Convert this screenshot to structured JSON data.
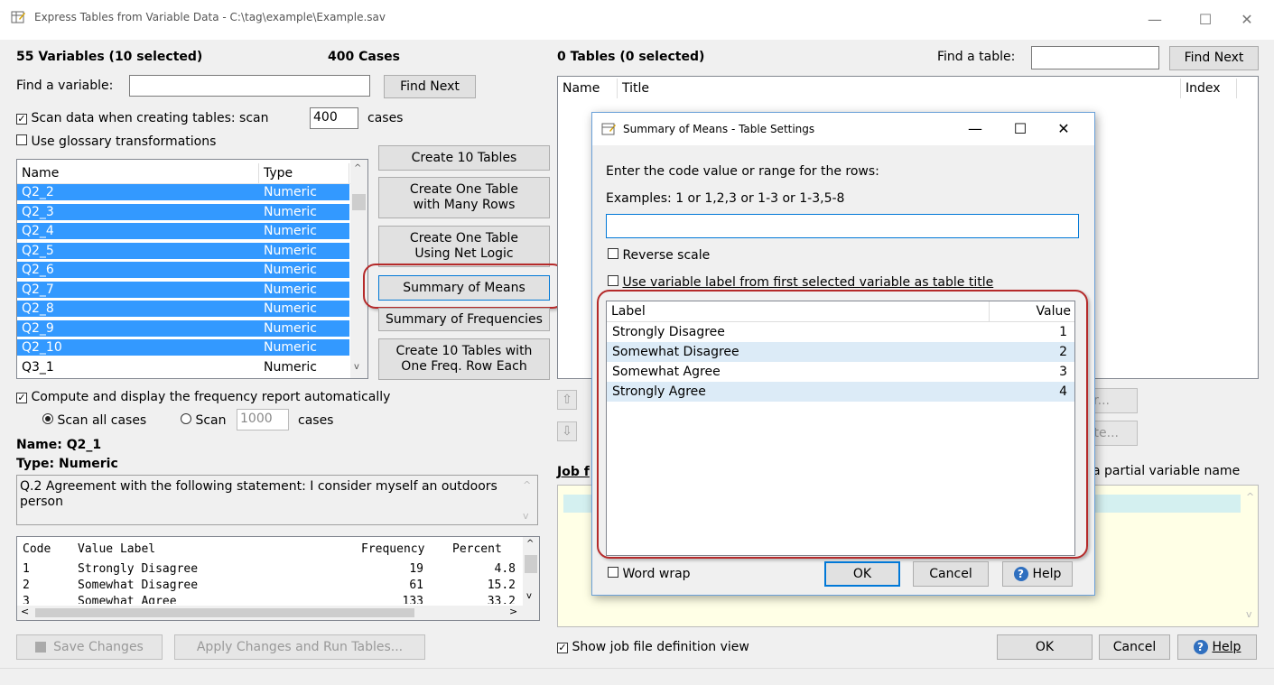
{
  "window": {
    "title": "Express Tables from Variable Data - C:\\tag\\example\\Example.sav",
    "minimize": "—",
    "maximize": "☐",
    "close": "✕"
  },
  "left": {
    "variables_count_label": "55 Variables  (10 selected)",
    "cases_label": "400 Cases",
    "find_variable_label": "Find a variable:",
    "find_variable_value": "",
    "find_next": "Find Next",
    "scan_data_label": "Scan data when creating tables:  scan",
    "scan_data_value": "400",
    "scan_cases_suffix": "cases",
    "glossary_label": "Use glossary transformations",
    "var_list_headers": {
      "name": "Name",
      "type": "Type"
    },
    "variables": [
      {
        "name": "Q2_2",
        "type": "Numeric",
        "selected": true
      },
      {
        "name": "Q2_3",
        "type": "Numeric",
        "selected": true
      },
      {
        "name": "Q2_4",
        "type": "Numeric",
        "selected": true
      },
      {
        "name": "Q2_5",
        "type": "Numeric",
        "selected": true
      },
      {
        "name": "Q2_6",
        "type": "Numeric",
        "selected": true
      },
      {
        "name": "Q2_7",
        "type": "Numeric",
        "selected": true
      },
      {
        "name": "Q2_8",
        "type": "Numeric",
        "selected": true
      },
      {
        "name": "Q2_9",
        "type": "Numeric",
        "selected": true
      },
      {
        "name": "Q2_10",
        "type": "Numeric",
        "selected": true
      },
      {
        "name": "Q3_1",
        "type": "Numeric",
        "selected": false
      }
    ],
    "compute_freq_label": "Compute and display the frequency report automatically",
    "scan_all_label": "Scan all cases",
    "scan_label": "Scan",
    "scan_value": "1000",
    "cases_label2": "cases",
    "name_line": "Name: Q2_1",
    "type_line": "Type: Numeric",
    "description": "Q.2 Agreement with the following statement: I consider myself an outdoors person",
    "freq_headers": {
      "code": "Code",
      "label": "Value Label",
      "freq": "Frequency",
      "pct": "Percent"
    },
    "freq_rows": [
      {
        "code": "1",
        "label": "Strongly Disagree",
        "freq": "19",
        "pct": "4.8"
      },
      {
        "code": "2",
        "label": "Somewhat Disagree",
        "freq": "61",
        "pct": "15.2"
      },
      {
        "code": "3",
        "label": "Somewhat Agree",
        "freq": "133",
        "pct": "33.2"
      }
    ],
    "save_changes": "Save Changes",
    "apply_run": "Apply Changes and Run Tables..."
  },
  "middle_buttons": {
    "create_10": "Create 10 Tables",
    "one_table_many_rows": [
      "Create One Table",
      "with Many Rows"
    ],
    "one_table_net": [
      "Create One Table",
      "Using Net Logic"
    ],
    "summary_means": "Summary of Means",
    "summary_freqs": "Summary of Frequencies",
    "ten_tables_one_row": [
      "Create 10 Tables with",
      "One Freq. Row Each"
    ]
  },
  "right": {
    "tables_count_label": "0 Tables  (0 selected)",
    "find_table_label": "Find a table:",
    "find_table_value": "",
    "find_next": "Find Next",
    "table_headers": {
      "name": "Name",
      "title": "Title",
      "index": "Index"
    },
    "partial_btn_1": "r...",
    "partial_btn_2": "te...",
    "job_file_label": "Job f",
    "partial_var_hint": "a partial variable name",
    "show_job_def": "Show job file definition view",
    "ok": "OK",
    "cancel": "Cancel",
    "help": "Help"
  },
  "dialog": {
    "title": "Summary of Means - Table Settings",
    "minimize": "—",
    "maximize": "☐",
    "close": "✕",
    "prompt": "Enter the code value or range for the rows:",
    "examples": "Examples: 1  or  1,2,3  or  1-3  or  1-3,5-8",
    "range_value": "",
    "reverse_scale": "Reverse scale",
    "use_var_label": "Use variable label from first selected variable as table title",
    "list_headers": {
      "label": "Label",
      "value": "Value"
    },
    "rows": [
      {
        "label": "Strongly Disagree",
        "value": "1"
      },
      {
        "label": "Somewhat Disagree",
        "value": "2"
      },
      {
        "label": "Somewhat Agree",
        "value": "3"
      },
      {
        "label": "Strongly Agree",
        "value": "4"
      }
    ],
    "word_wrap": "Word wrap",
    "ok": "OK",
    "cancel": "Cancel",
    "help": "Help"
  },
  "colors": {
    "selection": "#3399ff",
    "highlight_ring": "#b52a2a",
    "alt_row": "#dcebf7"
  }
}
